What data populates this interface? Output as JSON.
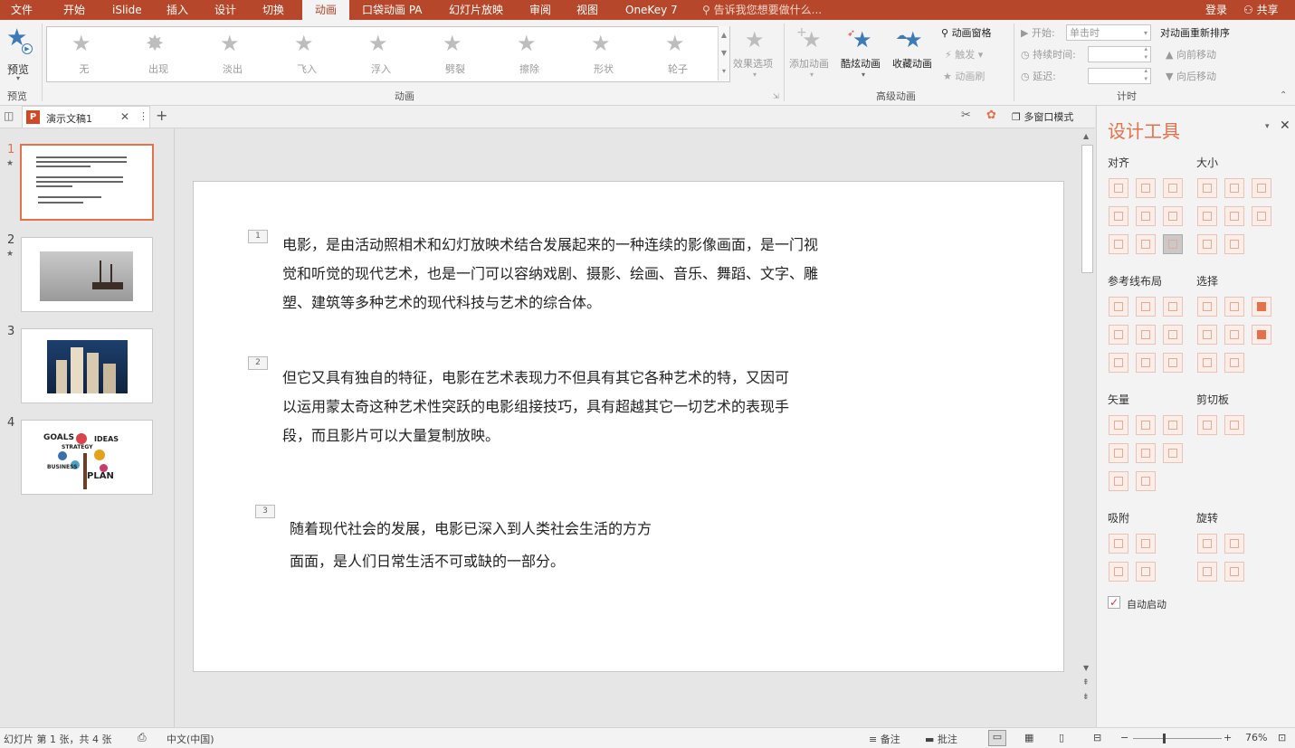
{
  "menu": {
    "items": [
      "文件",
      "开始",
      "iSlide",
      "插入",
      "设计",
      "切换",
      "动画",
      "口袋动画 PA",
      "幻灯片放映",
      "审阅",
      "视图",
      "OneKey 7"
    ],
    "active": "动画",
    "tell_me": "告诉我您想要做什么...",
    "login": "登录",
    "share": "共享"
  },
  "ribbon": {
    "preview": {
      "label": "预览",
      "group": "预览"
    },
    "animation_gallery": [
      "无",
      "出现",
      "淡出",
      "飞入",
      "浮入",
      "劈裂",
      "擦除",
      "形状",
      "轮子"
    ],
    "effect_options": "效果选项",
    "animation_group": "动画",
    "advanced": {
      "add": "添加动画",
      "cool": "酷炫动画",
      "fav": "收藏动画",
      "pane": "动画窗格",
      "trigger": "触发",
      "brush": "动画刷",
      "group": "高级动画"
    },
    "timing": {
      "start_label": "开始:",
      "start_value": "单击时",
      "duration_label": "持续时间:",
      "delay_label": "延迟:",
      "reorder": "对动画重新排序",
      "earlier": "向前移动",
      "later": "向后移动",
      "group": "计时"
    }
  },
  "tabstrip": {
    "doc_name": "演示文稿1",
    "multi_window": "多窗口模式"
  },
  "thumbs": [
    {
      "num": "1",
      "star": "★"
    },
    {
      "num": "2",
      "star": "★"
    },
    {
      "num": "3",
      "star": ""
    },
    {
      "num": "4",
      "star": ""
    }
  ],
  "thumb4_words": {
    "goals": "GOALS",
    "ideas": "IDEAS",
    "strategy": "STRATEGY",
    "business": "BUSINESS",
    "plan": "PLAN"
  },
  "slide": {
    "paragraphs": [
      {
        "tag": "1",
        "lines": [
          "电影，是由活动照相术和幻灯放映术结合发展起来的一种连续的影像画面，是一门视",
          "觉和听觉的现代艺术，也是一门可以容纳戏剧、摄影、绘画、音乐、舞蹈、文字、雕",
          "塑、建筑等多种艺术的现代科技与艺术的综合体。"
        ]
      },
      {
        "tag": "2",
        "lines": [
          "但它又具有独自的特征，电影在艺术表现力不但具有其它各种艺术的特，又因可",
          "以运用蒙太奇这种艺术性突跃的电影组接技巧，具有超越其它一切艺术的表现手",
          "段，而且影片可以大量复制放映。"
        ]
      },
      {
        "tag": "3",
        "lines": [
          "随着现代社会的发展，电影已深入到人类社会生活的方方",
          "面面，是人们日常生活不可或缺的一部分。"
        ]
      }
    ]
  },
  "design_pane": {
    "title": "设计工具",
    "sections": {
      "align": "对齐",
      "size": "大小",
      "guides": "参考线布局",
      "select": "选择",
      "vector": "矢量",
      "clipboard": "剪切板",
      "snap": "吸附",
      "rotate": "旋转"
    },
    "auto_start": "自动启动"
  },
  "status": {
    "slide_info": "幻灯片 第 1 张，共 4 张",
    "language": "中文(中国)",
    "notes": "备注",
    "comments": "批注",
    "zoom": "76%"
  },
  "colors": {
    "accent": "#b7472a",
    "design_accent": "#e5704a",
    "star_blue": "#3d7ab8"
  }
}
